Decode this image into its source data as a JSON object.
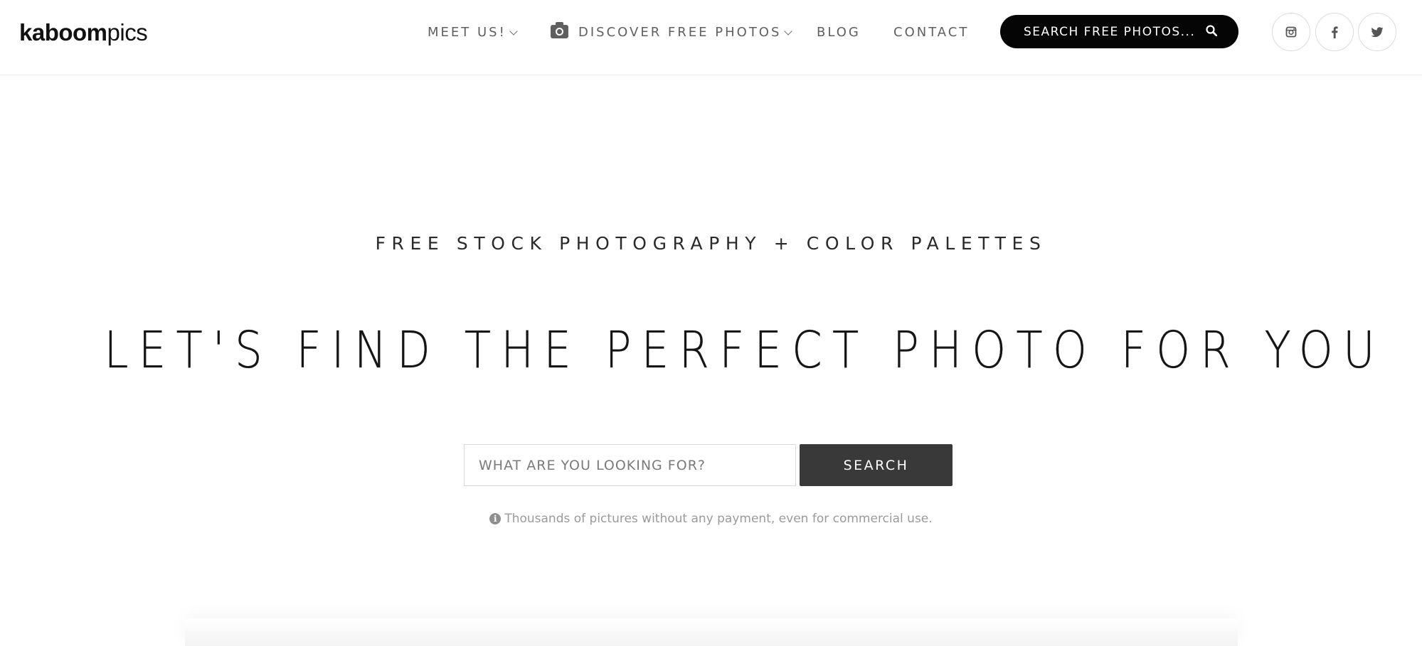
{
  "logo": {
    "bold": "kaboom",
    "light": "pics"
  },
  "nav": {
    "meet": "MEET US!",
    "discover": "DISCOVER FREE PHOTOS",
    "blog": "BLOG",
    "contact": "CONTACT"
  },
  "top_search": {
    "label": "SEARCH FREE PHOTOS..."
  },
  "social": [
    "instagram-icon",
    "facebook-icon",
    "twitter-icon"
  ],
  "hero": {
    "tagline": "FREE STOCK PHOTOGRAPHY + COLOR PALETTES",
    "headline": "LET'S FIND THE PERFECT PHOTO FOR YOU",
    "search_placeholder": "WHAT ARE YOU LOOKING FOR?",
    "search_value": "",
    "search_button": "SEARCH",
    "info": "Thousands of pictures without any payment, even for commercial use."
  },
  "colors": {
    "text": "#151515",
    "nav_text": "#5f5f5f",
    "search_pill": "#050505",
    "button": "#393939",
    "muted": "#9a9a9a"
  }
}
